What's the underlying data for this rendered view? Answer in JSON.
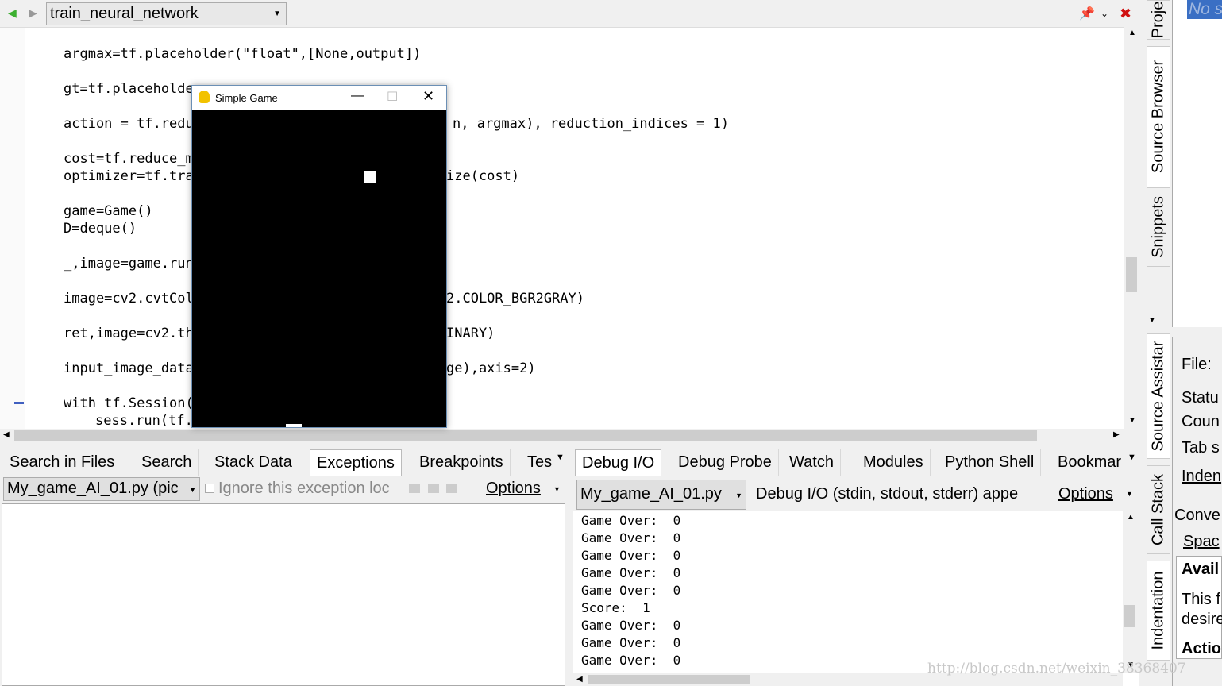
{
  "toolbar": {
    "function_select": "train_neural_network"
  },
  "editor": {
    "lines": [
      "argmax=tf.placeholder(\"float\",[None,output])",
      "gt=tf.placeholde",
      "action = tf.redu",
      "n, argmax), reduction_indices = 1)",
      "cost=tf.reduce_m",
      "optimizer=tf.tra",
      "ize(cost)",
      "game=Game()",
      "D=deque()",
      "_,image=game.run",
      "image=cv2.cvtCol",
      "2.COLOR_BGR2GRAY)",
      "ret,image=cv2.th",
      "INARY)",
      "input_image_data",
      "ge),axis=2)",
      "with tf.Session(",
      "sess.run(tf."
    ]
  },
  "game_window": {
    "title": "Simple Game"
  },
  "left_panel": {
    "tabs": [
      "Search in Files",
      "Search",
      "Stack Data",
      "Exceptions",
      "Breakpoints",
      "Tes"
    ],
    "active_tab": "Exceptions",
    "file_select": "My_game_AI_01.py (pic",
    "ignore_label": "Ignore this exception loc",
    "options_label": "Options"
  },
  "right_panel": {
    "tabs": [
      "Debug I/O",
      "Debug Probe",
      "Watch",
      "Modules",
      "Python Shell",
      "Bookmar"
    ],
    "active_tab": "Debug I/O",
    "file_select": "My_game_AI_01.py",
    "description": "Debug I/O (stdin, stdout, stderr) appe",
    "options_label": "Options",
    "output": [
      "Game Over:  0",
      "Game Over:  0",
      "Game Over:  0",
      "Game Over:  0",
      "Game Over:  0",
      "Score:  1",
      "Game Over:  0",
      "Game Over:  0",
      "Game Over:  0"
    ]
  },
  "side_tabs": [
    "Proje",
    "Source Browser",
    "Snippets",
    "Source Assistar",
    "Call Stack",
    "Indentation"
  ],
  "side_panel": {
    "top_text": "No s",
    "file_label": "File:",
    "status_label": "Statu",
    "count_label": "Coun",
    "tab_label": "Tab s",
    "indent_label": "Inden",
    "convert_label": "Conve",
    "spaces_label": "Spac",
    "avail_label": "Avail",
    "this_text": "This f",
    "desire_text": "desire",
    "action_label": "Actio"
  },
  "watermark": "http://blog.csdn.net/weixin_38368407"
}
